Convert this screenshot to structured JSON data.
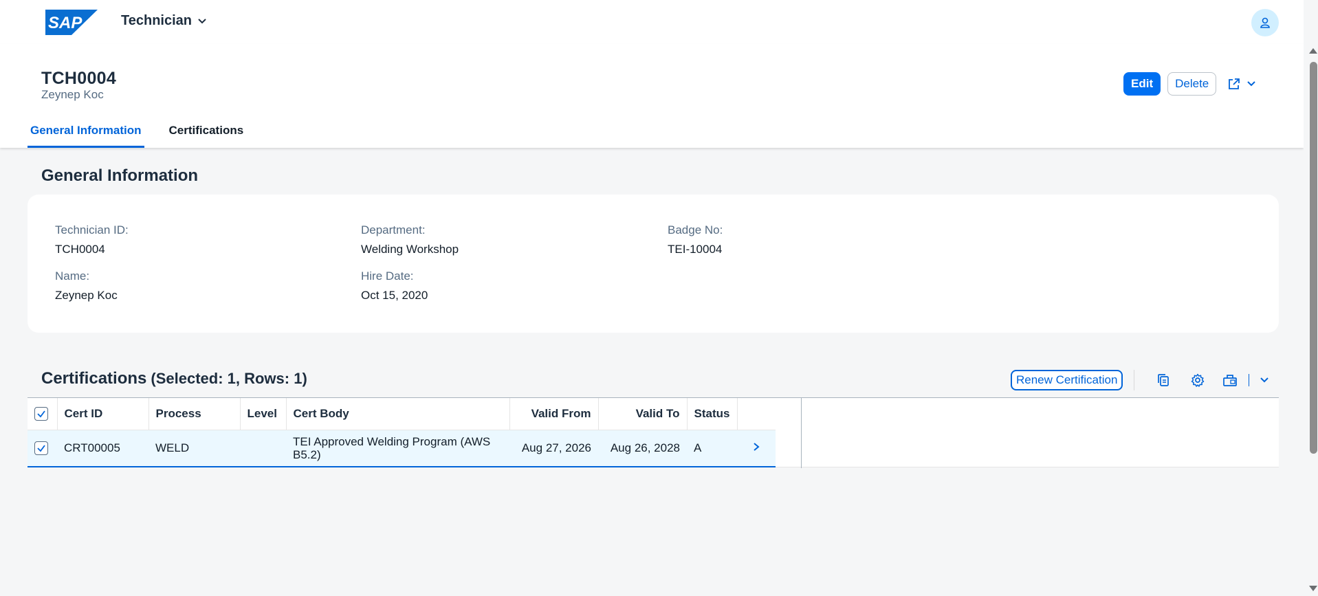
{
  "shell": {
    "logo_text": "SAP",
    "app_title": "Technician",
    "logo_color": "#0a6ed1"
  },
  "header": {
    "title": "TCH0004",
    "subtitle": "Zeynep Koc",
    "actions": {
      "edit": "Edit",
      "delete": "Delete"
    }
  },
  "tabs": [
    {
      "label": "General Information",
      "active": true
    },
    {
      "label": "Certifications",
      "active": false
    }
  ],
  "general": {
    "section_title": "General Information",
    "fields": {
      "technician_id": {
        "label": "Technician ID:",
        "value": "TCH0004"
      },
      "department": {
        "label": "Department:",
        "value": "Welding Workshop"
      },
      "badge_no": {
        "label": "Badge No:",
        "value": "TEI-10004"
      },
      "name": {
        "label": "Name:",
        "value": "Zeynep Koc"
      },
      "hire_date": {
        "label": "Hire Date:",
        "value": "Oct 15, 2020"
      }
    }
  },
  "certifications": {
    "title": "Certifications",
    "count_text": "(Selected: 1, Rows: 1)",
    "renew_label": "Renew Certification",
    "columns": [
      "Cert ID",
      "Process",
      "Level",
      "Cert Body",
      "Valid From",
      "Valid To",
      "Status"
    ],
    "rows": [
      {
        "cert_id": "CRT00005",
        "process": "WELD",
        "level": "",
        "cert_body": "TEI Approved Welding Program (AWS B5.2)",
        "valid_from": "Aug 27, 2026",
        "valid_to": "Aug 26, 2028",
        "status": "A",
        "selected": true
      }
    ]
  },
  "colors": {
    "accent": "#0064d9",
    "emphasized": "#0070f2",
    "selected_row": "#ebf8ff",
    "background": "#f5f6f7"
  }
}
